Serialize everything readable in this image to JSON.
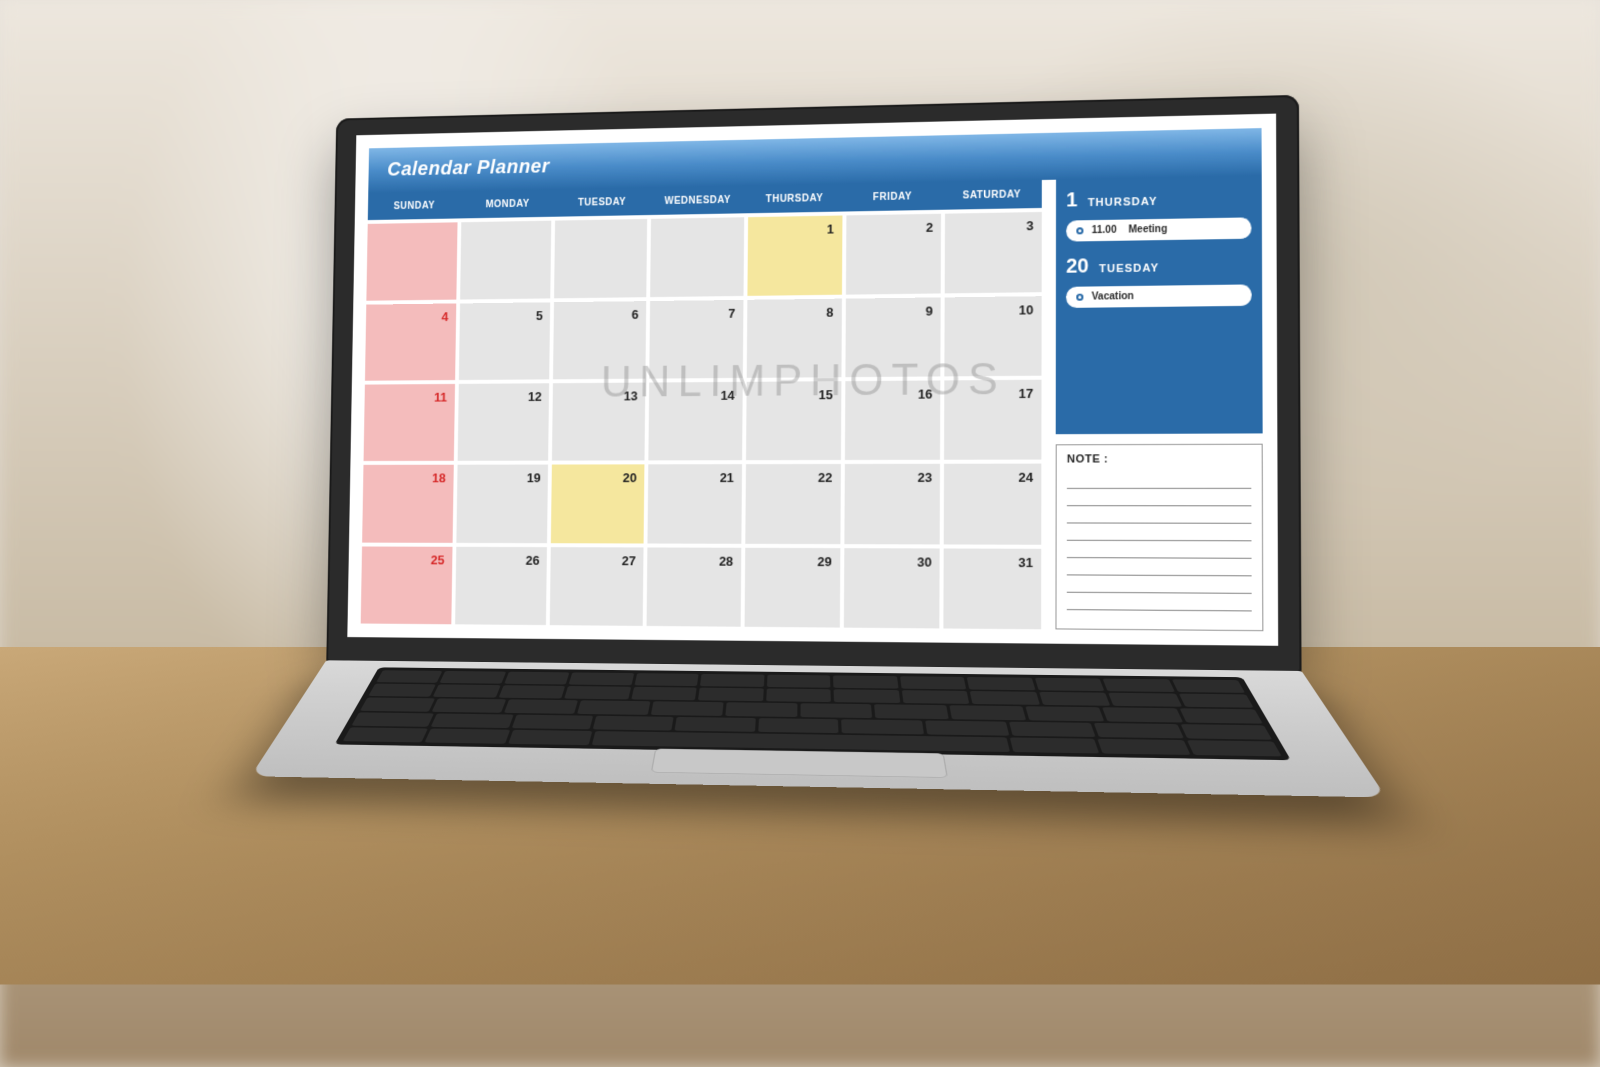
{
  "app": {
    "title": "Calendar Planner"
  },
  "dayHeaders": [
    "SUNDAY",
    "MONDAY",
    "TUESDAY",
    "WEDNESDAY",
    "THURSDAY",
    "FRIDAY",
    "SATURDAY"
  ],
  "weeks": [
    [
      {
        "num": "",
        "cls": "sunday"
      },
      {
        "num": "",
        "cls": ""
      },
      {
        "num": "",
        "cls": ""
      },
      {
        "num": "",
        "cls": ""
      },
      {
        "num": "1",
        "cls": "highlight"
      },
      {
        "num": "2",
        "cls": ""
      },
      {
        "num": "3",
        "cls": ""
      }
    ],
    [
      {
        "num": "4",
        "cls": "sunday"
      },
      {
        "num": "5",
        "cls": ""
      },
      {
        "num": "6",
        "cls": ""
      },
      {
        "num": "7",
        "cls": ""
      },
      {
        "num": "8",
        "cls": ""
      },
      {
        "num": "9",
        "cls": ""
      },
      {
        "num": "10",
        "cls": ""
      }
    ],
    [
      {
        "num": "11",
        "cls": "sunday"
      },
      {
        "num": "12",
        "cls": ""
      },
      {
        "num": "13",
        "cls": ""
      },
      {
        "num": "14",
        "cls": ""
      },
      {
        "num": "15",
        "cls": ""
      },
      {
        "num": "16",
        "cls": ""
      },
      {
        "num": "17",
        "cls": ""
      }
    ],
    [
      {
        "num": "18",
        "cls": "sunday"
      },
      {
        "num": "19",
        "cls": ""
      },
      {
        "num": "20",
        "cls": "highlight"
      },
      {
        "num": "21",
        "cls": ""
      },
      {
        "num": "22",
        "cls": ""
      },
      {
        "num": "23",
        "cls": ""
      },
      {
        "num": "24",
        "cls": ""
      }
    ],
    [
      {
        "num": "25",
        "cls": "sunday"
      },
      {
        "num": "26",
        "cls": ""
      },
      {
        "num": "27",
        "cls": ""
      },
      {
        "num": "28",
        "cls": ""
      },
      {
        "num": "29",
        "cls": ""
      },
      {
        "num": "30",
        "cls": ""
      },
      {
        "num": "31",
        "cls": ""
      }
    ]
  ],
  "sidebar": {
    "blocks": [
      {
        "date": "1",
        "day": "THURSDAY",
        "events": [
          {
            "time": "11.00",
            "label": "Meeting"
          }
        ]
      },
      {
        "date": "20",
        "day": "TUESDAY",
        "events": [
          {
            "time": "",
            "label": "Vacation"
          }
        ]
      }
    ]
  },
  "note": {
    "title": "NOTE :"
  },
  "watermark": "UNLIMPHOTOS"
}
